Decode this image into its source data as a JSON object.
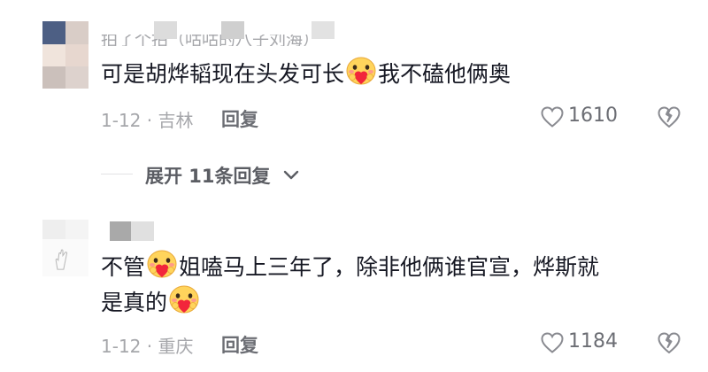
{
  "comments": [
    {
      "username": "拍了个拍（咕咕的八子刘海）",
      "text_before": "可是胡烨韬现在头发可长",
      "text_after": "我不磕他俩奥",
      "date_location": "1-12 · 吉林",
      "reply_label": "回复",
      "like_count": "1610",
      "emoji": "heart-hug-emoji"
    },
    {
      "username": "",
      "line1_before": "不管",
      "line1_after": "姐嗑马上三年了，除非他俩谁官宣，烨斯就",
      "line2_before": "是真的",
      "date_location": "1-12 · 重庆",
      "reply_label": "回复",
      "like_count": "1184",
      "emoji": "heart-hug-emoji"
    }
  ],
  "expand": {
    "label": "展开 11条回复"
  },
  "colors": {
    "text": "#161823",
    "meta": "#a6a7ab",
    "reply": "#6c6e74"
  }
}
